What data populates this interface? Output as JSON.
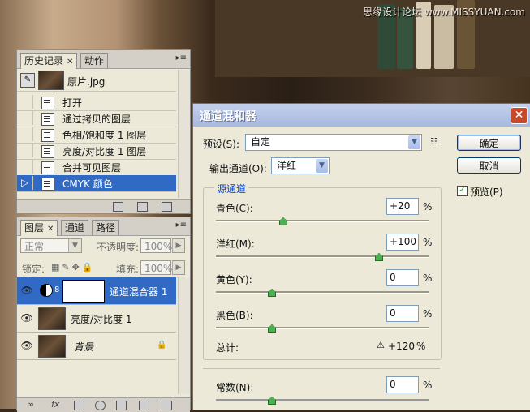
{
  "watermark": "思缘设计论坛 www.MISSYUAN.com",
  "history_panel": {
    "tabs": [
      "历史记录",
      "动作"
    ],
    "snapshot": "原片.jpg",
    "items": [
      "打开",
      "通过拷贝的图层",
      "色相/饱和度 1 图层",
      "亮度/对比度 1 图层",
      "合并可见图层",
      "CMYK 颜色"
    ],
    "selected_index": 5
  },
  "layers_panel": {
    "tabs": [
      "图层",
      "通道",
      "路径"
    ],
    "blend_mode": "正常",
    "opacity_label": "不透明度:",
    "opacity_value": "100%",
    "lock_label": "锁定:",
    "fill_label": "填充:",
    "fill_value": "100%",
    "layers": [
      {
        "name": "通道混合器 1",
        "selected": true
      },
      {
        "name": "亮度/对比度 1",
        "selected": false
      },
      {
        "name": "背景",
        "selected": false,
        "locked": true
      }
    ]
  },
  "dialog": {
    "title": "通道混和器",
    "preset_label": "预设(S):",
    "preset_value": "自定",
    "output_label": "输出通道(O):",
    "output_value": "洋红",
    "source_group": "源通道",
    "sliders": [
      {
        "label": "青色(C):",
        "value": "+20",
        "unit": "%",
        "fraction": 0.6
      },
      {
        "label": "洋红(M):",
        "value": "+100",
        "unit": "%",
        "fraction": 1.0
      },
      {
        "label": "黄色(Y):",
        "value": "0",
        "unit": "%",
        "fraction": 0.5
      },
      {
        "label": "黑色(B):",
        "value": "0",
        "unit": "%",
        "fraction": 0.5
      }
    ],
    "total_label": "总计:",
    "total_value": "+120",
    "total_unit": "%",
    "constant_label": "常数(N):",
    "constant_value": "0",
    "constant_unit": "%",
    "constant_fraction": 0.5,
    "ok_label": "确定",
    "cancel_label": "取消",
    "preview_label": "预览(P)",
    "preview_checked": true
  },
  "colors": {
    "selection": "#316ac5",
    "dialog_title": "#a8b9df",
    "group_label": "#0046d5"
  }
}
